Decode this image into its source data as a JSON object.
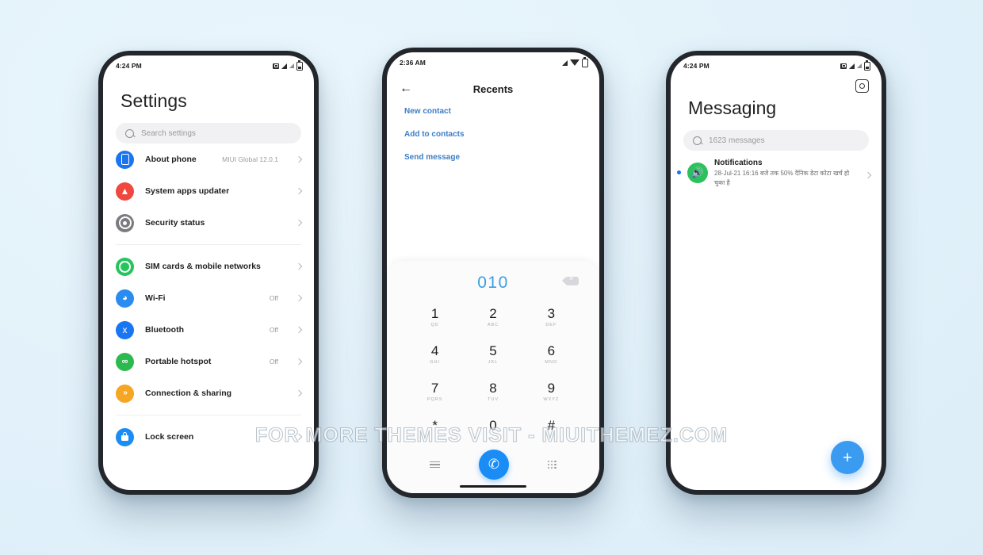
{
  "background_color": "#e2f1fa",
  "accent_blue": "#1a8cf5",
  "watermark": "FOR MORE THEMES VISIT - MIUITHEMEZ.COM",
  "phones": {
    "settings": {
      "status": {
        "time": "4:24 PM",
        "icons": [
          "sim-icon",
          "signal-icon",
          "signal-icon",
          "battery-icon"
        ]
      },
      "title": "Settings",
      "search": {
        "placeholder": "Search settings",
        "icon": "search-icon"
      },
      "groups": [
        {
          "rows": [
            {
              "label": "About phone",
              "value": "MIUI Global 12.0.1",
              "icon": "about-phone-icon",
              "color": "#1976f0"
            },
            {
              "label": "System apps updater",
              "value": "",
              "icon": "updater-icon",
              "color": "#f0483e"
            },
            {
              "label": "Security status",
              "value": "",
              "icon": "security-icon",
              "color": "#7b7b80"
            }
          ]
        },
        {
          "rows": [
            {
              "label": "SIM cards & mobile networks",
              "value": "",
              "icon": "sim-card-icon",
              "color": "#26c45e"
            },
            {
              "label": "Wi-Fi",
              "value": "Off",
              "icon": "wifi-icon",
              "color": "#2a8cf0"
            },
            {
              "label": "Bluetooth",
              "value": "Off",
              "icon": "bluetooth-icon",
              "color": "#1876f2"
            },
            {
              "label": "Portable hotspot",
              "value": "Off",
              "icon": "hotspot-icon",
              "color": "#2cb94f"
            },
            {
              "label": "Connection & sharing",
              "value": "",
              "icon": "connection-sharing-icon",
              "color": "#f5a623"
            }
          ]
        },
        {
          "rows": [
            {
              "label": "Lock screen",
              "value": "",
              "icon": "lock-icon",
              "color": "#1a8cf5"
            }
          ]
        }
      ]
    },
    "dialer": {
      "status": {
        "time": "2:36 AM",
        "icons": [
          "signal-icon",
          "wifi-icon",
          "battery-icon"
        ]
      },
      "back_icon": "back-arrow-icon",
      "title": "Recents",
      "actions": [
        {
          "label": "New contact"
        },
        {
          "label": "Add to contacts"
        },
        {
          "label": "Send message"
        }
      ],
      "dialed_number": "010",
      "backspace_icon": "backspace-icon",
      "keys": [
        {
          "num": "1",
          "sub": "QD"
        },
        {
          "num": "2",
          "sub": "ABC"
        },
        {
          "num": "3",
          "sub": "DEF"
        },
        {
          "num": "4",
          "sub": "GHI"
        },
        {
          "num": "5",
          "sub": "JKL"
        },
        {
          "num": "6",
          "sub": "MNO"
        },
        {
          "num": "7",
          "sub": "PQRS"
        },
        {
          "num": "8",
          "sub": "TUV"
        },
        {
          "num": "9",
          "sub": "WXYZ"
        },
        {
          "num": "*",
          "sub": ""
        },
        {
          "num": "0",
          "sub": ""
        },
        {
          "num": "#",
          "sub": ""
        }
      ],
      "bottom": {
        "menu_icon": "menu-icon",
        "call_icon": "✆",
        "keypad_icon": "keypad-icon"
      }
    },
    "messaging": {
      "status": {
        "time": "4:24 PM",
        "icons": [
          "sim-icon",
          "signal-icon",
          "signal-icon",
          "battery-icon"
        ]
      },
      "settings_icon": "gear-icon",
      "title": "Messaging",
      "search": {
        "placeholder": "1623 messages",
        "icon": "search-icon"
      },
      "conversations": [
        {
          "name": "Notifications",
          "preview": "28-Jul-21 16:16 बजे तक 50% दैनिक डेटा कोटा खर्च हो चुका है",
          "unread": true,
          "avatar_icon": "speaker-icon",
          "avatar_color": "#2cc15e"
        }
      ],
      "fab": {
        "icon": "plus-icon",
        "label": "+"
      }
    }
  }
}
